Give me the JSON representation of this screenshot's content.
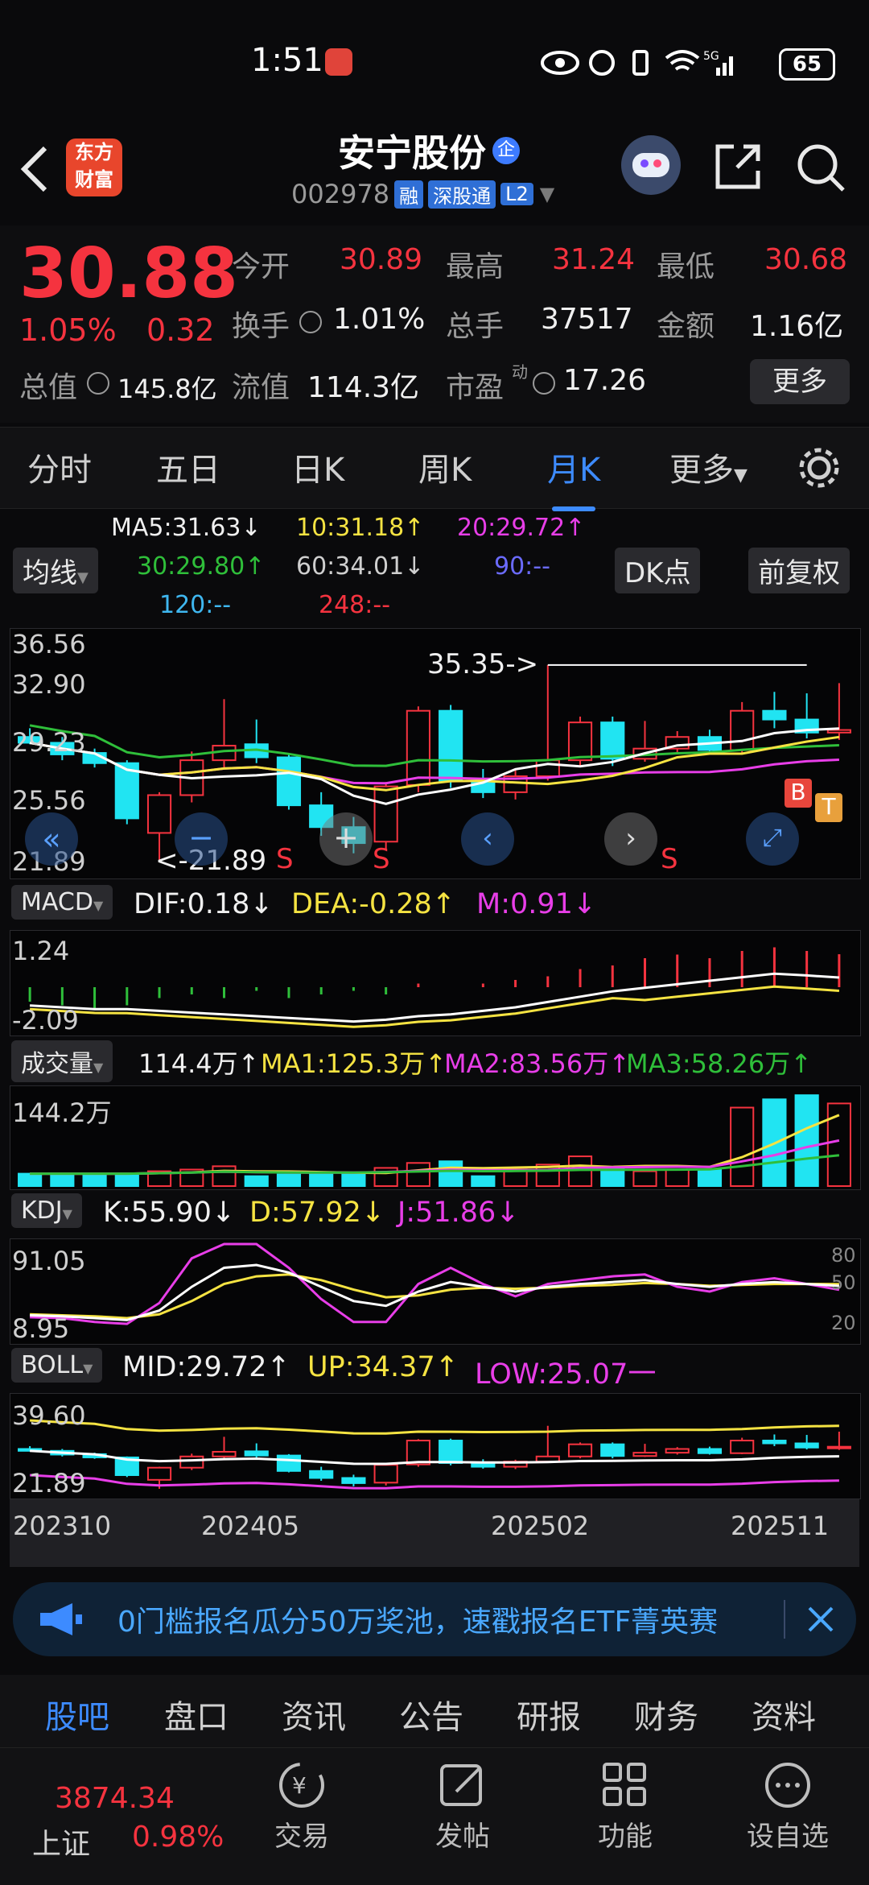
{
  "status_bar": {
    "time": "1:51",
    "network": "5G",
    "battery": "65"
  },
  "header": {
    "logo_line1": "东方",
    "logo_line2": "财富",
    "stock_name": "安宁股份",
    "stock_badge": "企",
    "code": "002978",
    "chip_rong": "融",
    "chip_sgt": "深股通",
    "chip_l2": "L2"
  },
  "quote": {
    "price": "30.88",
    "change_pct": "1.05%",
    "change": "0.32",
    "open_label": "今开",
    "open": "30.89",
    "high_label": "最高",
    "high": "31.24",
    "low_label": "最低",
    "low": "30.68",
    "turnover_label": "换手",
    "turnover": "1.01%",
    "volume_label": "总手",
    "volume": "37517",
    "amount_label": "金额",
    "amount": "1.16亿",
    "total_cap_label": "总值",
    "total_cap": "145.8亿",
    "float_cap_label": "流值",
    "float_cap": "114.3亿",
    "pe_label": "市盈",
    "pe_sup": "动",
    "pe": "17.26",
    "more_button": "更多"
  },
  "tabs": [
    "分时",
    "五日",
    "日K",
    "周K",
    "月K",
    "更多"
  ],
  "active_tab": "月K",
  "chart_controls": {
    "ma_selector": "均线",
    "dk_button": "DK点",
    "fq_button": "前复权",
    "ma5": "MA5:31.63↓",
    "ma10": "10:31.18↑",
    "ma20": "20:29.72↑",
    "ma30": "30:29.80↑",
    "ma60": "60:34.01↓",
    "ma90": "90:--",
    "ma120": "120:--",
    "ma248": "248:--"
  },
  "main_chart": {
    "y_ticks": [
      "36.56",
      "32.90",
      "29.23",
      "25.56",
      "21.89"
    ],
    "high_annotation": "35.35->",
    "low_annotation": "<-21.89",
    "signal_s": "S",
    "signal_b": "B",
    "signal_t": "T"
  },
  "macd": {
    "selector": "MACD",
    "dif": "DIF:0.18↓",
    "dea": "DEA:-0.28↑",
    "m": "M:0.91↓",
    "y_top": "1.24",
    "y_bottom": "-2.09"
  },
  "volume_panel": {
    "selector": "成交量",
    "vol": "114.4万↑",
    "ma1": "MA1:125.3万↑",
    "ma2": "MA2:83.56万↑",
    "ma3": "MA3:58.26万↑",
    "y_top": "144.2万"
  },
  "kdj": {
    "selector": "KDJ",
    "k": "K:55.90↓",
    "d": "D:57.92↓",
    "j": "J:51.86↓",
    "y_top": "91.05",
    "y_bottom": "8.95",
    "r80": "80",
    "r50": "50",
    "r20": "20"
  },
  "boll": {
    "selector": "BOLL",
    "mid": "MID:29.72↑",
    "up": "UP:34.37↑",
    "low": "LOW:25.07一",
    "y_top": "39.60",
    "y_bottom": "21.89"
  },
  "x_axis": [
    "202310",
    "202405",
    "202502",
    "202511"
  ],
  "ad_banner": {
    "text": "0门槛报名瓜分50万奖池，速戳报名ETF菁英赛"
  },
  "sub_tabs": [
    "股吧",
    "盘口",
    "资讯",
    "公告",
    "研报",
    "财务",
    "资料"
  ],
  "active_sub_tab": "股吧",
  "index_ticker": {
    "value": "3874.34",
    "name": "上证",
    "change": "0.98%"
  },
  "bottom_nav": [
    "交易",
    "发帖",
    "功能",
    "设自选"
  ],
  "colors": {
    "up": "#f5333f",
    "down": "#21e4f2",
    "accent": "#3d8bff",
    "ma5": "#ffffff",
    "ma10": "#f5e342",
    "ma20": "#e83ee8",
    "ma30": "#2fbf3a"
  },
  "chart_data": {
    "type": "candlestick",
    "ohlc": [
      [
        30.4,
        30.0,
        31.0,
        29.9
      ],
      [
        30.0,
        29.2,
        30.4,
        28.8
      ],
      [
        29.3,
        28.6,
        29.6,
        28.3
      ],
      [
        28.6,
        24.8,
        28.8,
        24.4
      ],
      [
        23.8,
        26.4,
        26.6,
        21.89
      ],
      [
        26.4,
        28.8,
        29.4,
        25.9
      ],
      [
        28.8,
        29.8,
        33.0,
        28.2
      ],
      [
        29.9,
        29.0,
        31.6,
        28.6
      ],
      [
        29.0,
        25.7,
        29.3,
        25.4
      ],
      [
        25.7,
        24.2,
        26.6,
        23.6
      ],
      [
        24.2,
        23.1,
        24.9,
        22.4
      ],
      [
        23.2,
        27.0,
        27.3,
        22.6
      ],
      [
        27.1,
        32.2,
        32.5,
        26.6
      ],
      [
        32.2,
        27.4,
        32.6,
        26.9
      ],
      [
        27.4,
        26.6,
        28.2,
        26.2
      ],
      [
        26.6,
        27.7,
        28.1,
        26.1
      ],
      [
        27.7,
        28.8,
        35.35,
        27.4
      ],
      [
        28.8,
        31.4,
        31.8,
        28.4
      ],
      [
        31.4,
        28.9,
        31.8,
        28.4
      ],
      [
        28.9,
        29.6,
        31.5,
        28.7
      ],
      [
        29.6,
        30.4,
        30.8,
        29.2
      ],
      [
        30.4,
        29.5,
        30.9,
        29.2
      ],
      [
        29.5,
        32.2,
        32.8,
        29.3
      ],
      [
        32.2,
        31.6,
        33.5,
        31.0
      ],
      [
        31.6,
        30.7,
        33.4,
        30.3
      ],
      [
        30.7,
        30.88,
        34.1,
        30.2
      ]
    ],
    "volume": [
      15,
      15,
      15,
      15,
      18,
      20,
      24,
      12,
      14,
      15,
      16,
      22,
      28,
      30,
      12,
      20,
      26,
      36,
      22,
      18,
      20,
      20,
      95,
      105,
      110,
      100
    ]
  }
}
